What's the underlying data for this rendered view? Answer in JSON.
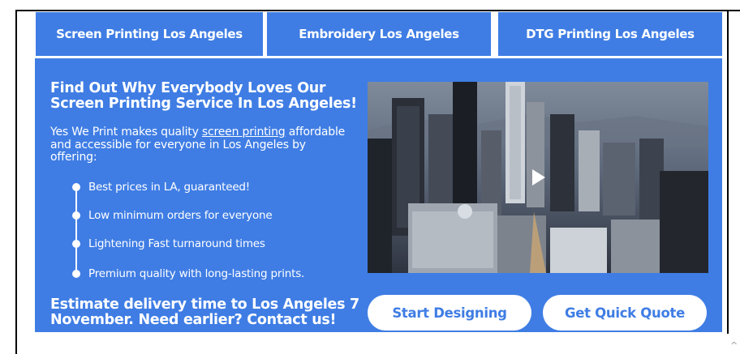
{
  "tabs": [
    {
      "label": "Screen Printing Los Angeles"
    },
    {
      "label": "Embroidery Los Angeles"
    },
    {
      "label": "DTG Printing Los Angeles"
    }
  ],
  "panel": {
    "headline": "Find Out Why Everybody Loves Our Screen Printing Service In Los Angeles!",
    "intro_before": "Yes We Print makes quality ",
    "intro_link": "screen printing",
    "intro_after": " affordable and accessible for everyone in Los Angeles by offering:",
    "bullets": [
      "Best prices in LA, guaranteed!",
      "Low minimum orders for everyone",
      "Lightening Fast turnaround times",
      "Premium quality with long-lasting prints."
    ],
    "delivery_text": "Estimate delivery time to Los Angeles 7 November. Need earlier? Contact us!"
  },
  "buttons": {
    "start": "Start Designing",
    "quote": "Get Quick Quote"
  },
  "misc": {
    "corner_glyph": "^"
  },
  "colors": {
    "brand_blue": "#3f7de4",
    "white": "#ffffff"
  }
}
